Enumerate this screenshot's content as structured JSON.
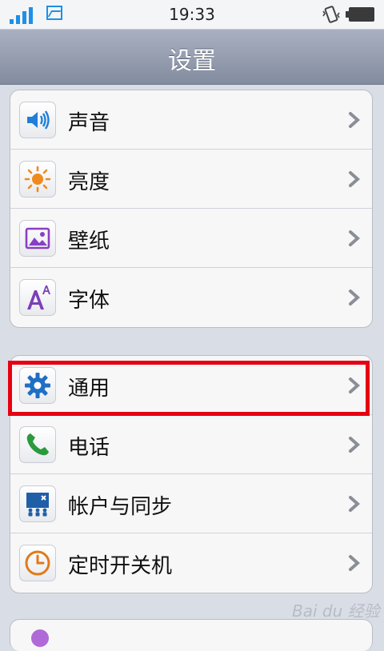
{
  "status_bar": {
    "time": "19:33"
  },
  "header": {
    "title": "设置"
  },
  "groups": [
    {
      "items": [
        {
          "label": "声音",
          "icon": "speaker-icon"
        },
        {
          "label": "亮度",
          "icon": "sun-icon"
        },
        {
          "label": "壁纸",
          "icon": "wallpaper-icon"
        },
        {
          "label": "字体",
          "icon": "font-icon"
        }
      ]
    },
    {
      "items": [
        {
          "label": "通用",
          "icon": "gear-icon"
        },
        {
          "label": "电话",
          "icon": "phone-icon"
        },
        {
          "label": "帐户与同步",
          "icon": "sync-icon"
        },
        {
          "label": "定时开关机",
          "icon": "clock-icon"
        }
      ]
    }
  ],
  "colors": {
    "highlight": "#e60012",
    "accent": "#1e90e6"
  },
  "watermark": "Bai du 经验"
}
